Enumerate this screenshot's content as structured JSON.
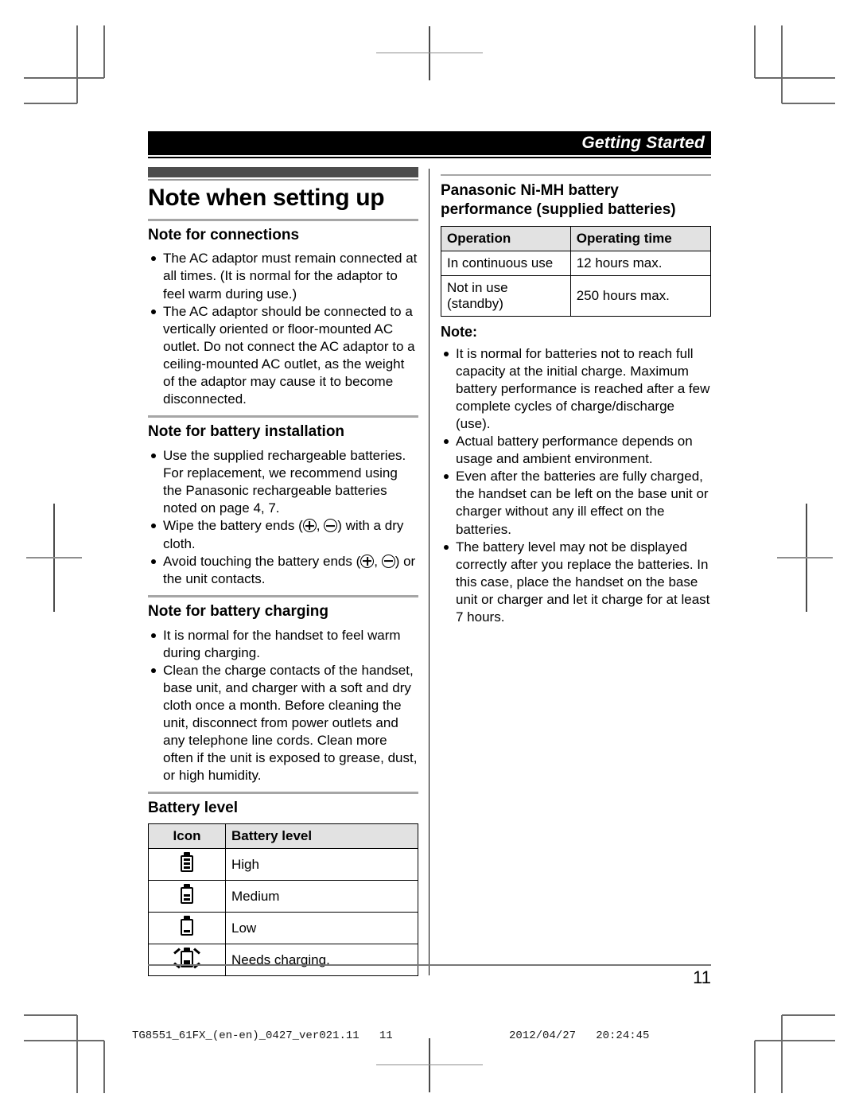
{
  "header": {
    "title": "Getting Started"
  },
  "left_column": {
    "chapter_title": "Note when setting up",
    "sections": [
      {
        "heading": "Note for connections",
        "bullets": [
          "The AC adaptor must remain connected at all times. (It is normal for the adaptor to feel warm during use.)",
          "The AC adaptor should be connected to a vertically oriented or floor-mounted AC outlet. Do not connect the AC adaptor to a ceiling-mounted AC outlet, as the weight of the adaptor may cause it to become disconnected."
        ]
      },
      {
        "heading": "Note for battery installation",
        "bullets": [
          "Use the supplied rechargeable batteries. For replacement, we recommend using the Panasonic rechargeable batteries noted on page 4, 7.",
          "Wipe the battery ends (⊕, ⊖) with a dry cloth.",
          "Avoid touching the battery ends (⊕, ⊖) or the unit contacts."
        ],
        "bullet_parts": {
          "wipe_pre": "Wipe the battery ends (",
          "wipe_mid": ", ",
          "wipe_post": ") with a dry cloth.",
          "avoid_pre": "Avoid touching the battery ends (",
          "avoid_mid": ", ",
          "avoid_post": ") or the unit contacts."
        }
      },
      {
        "heading": "Note for battery charging",
        "bullets": [
          "It is normal for the handset to feel warm during charging.",
          "Clean the charge contacts of the handset, base unit, and charger with a soft and dry cloth once a month. Before cleaning the unit, disconnect from power outlets and any telephone line cords. Clean more often if the unit is exposed to grease, dust, or high humidity."
        ]
      }
    ],
    "battery_level": {
      "heading": "Battery level",
      "table": {
        "headers": [
          "Icon",
          "Battery level"
        ],
        "rows": [
          {
            "icon": "battery-high-icon",
            "level": "High"
          },
          {
            "icon": "battery-medium-icon",
            "level": "Medium"
          },
          {
            "icon": "battery-low-icon",
            "level": "Low"
          },
          {
            "icon": "battery-flashing-icon",
            "level": "Needs charging."
          }
        ]
      }
    }
  },
  "right_column": {
    "heading_line1": "Panasonic Ni-MH battery",
    "heading_line2": "performance (supplied batteries)",
    "table": {
      "headers": [
        "Operation",
        "Operating time"
      ],
      "rows": [
        [
          "In continuous use",
          "12 hours max."
        ],
        [
          "Not in use (standby)",
          "250 hours max."
        ]
      ]
    },
    "note_label": "Note:",
    "note_bullets": [
      "It is normal for batteries not to reach full capacity at the initial charge. Maximum battery performance is reached after a few complete cycles of charge/discharge (use).",
      "Actual battery performance depends on usage and ambient environment.",
      "Even after the batteries are fully charged, the handset can be left on the base unit or charger without any ill effect on the batteries.",
      "The battery level may not be displayed correctly after you replace the batteries. In this case, place the handset on the base unit or charger and let it charge for at least 7 hours."
    ]
  },
  "page_number": "11",
  "print_slug": {
    "left": "TG8551_61FX_(en-en)_0427_ver021.11   11",
    "right": "2012/04/27   20:24:45"
  },
  "colors": {
    "header_bar": "#000000",
    "chapter_bar": "#4d4d4d",
    "rule_gray": "#a6a6a6",
    "table_header_bg": "#e2e2e2",
    "crop_mark": "#6b6b6b"
  }
}
